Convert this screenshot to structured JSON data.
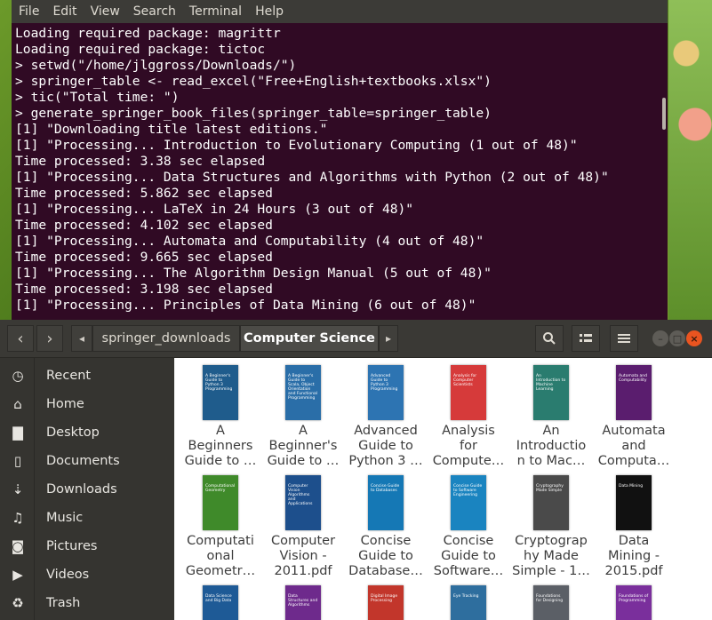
{
  "terminal": {
    "menu": [
      "File",
      "Edit",
      "View",
      "Search",
      "Terminal",
      "Help"
    ],
    "lines": [
      "Loading required package: magrittr",
      "Loading required package: tictoc",
      "> setwd(\"/home/jlggross/Downloads/\")",
      "> springer_table <- read_excel(\"Free+English+textbooks.xlsx\")",
      "> tic(\"Total time: \")",
      "> generate_springer_book_files(springer_table=springer_table)",
      "[1] \"Downloading title latest editions.\"",
      "[1] \"Processing... Introduction to Evolutionary Computing (1 out of 48)\"",
      "Time processed: 3.38 sec elapsed",
      "[1] \"Processing... Data Structures and Algorithms with Python (2 out of 48)\"",
      "Time processed: 5.862 sec elapsed",
      "[1] \"Processing... LaTeX in 24 Hours (3 out of 48)\"",
      "Time processed: 4.102 sec elapsed",
      "[1] \"Processing... Automata and Computability (4 out of 48)\"",
      "Time processed: 9.665 sec elapsed",
      "[1] \"Processing... The Algorithm Design Manual (5 out of 48)\"",
      "Time processed: 3.198 sec elapsed",
      "[1] \"Processing... Principles of Data Mining (6 out of 48)\""
    ]
  },
  "files": {
    "breadcrumb": [
      "springer_downloads",
      "Computer Science"
    ],
    "nav": {
      "back": "‹",
      "forward": "›",
      "crumb_left": "◂",
      "crumb_right": "▸"
    },
    "toolbar": {
      "search_icon": "search-icon",
      "view_icon": "list-view-icon",
      "menu_icon": "hamburger-menu-icon"
    },
    "window_controls": {
      "minimize": "–",
      "maximize": "□",
      "close": "×"
    },
    "sidebar": [
      {
        "label": "Recent",
        "icon": "clock-icon",
        "glyph": "◷"
      },
      {
        "label": "Home",
        "icon": "home-icon",
        "glyph": "⌂"
      },
      {
        "label": "Desktop",
        "icon": "folder-icon",
        "glyph": "▇"
      },
      {
        "label": "Documents",
        "icon": "document-icon",
        "glyph": "▯"
      },
      {
        "label": "Downloads",
        "icon": "download-icon",
        "glyph": "⇣"
      },
      {
        "label": "Music",
        "icon": "music-icon",
        "glyph": "♫"
      },
      {
        "label": "Pictures",
        "icon": "camera-icon",
        "glyph": "◙"
      },
      {
        "label": "Videos",
        "icon": "video-icon",
        "glyph": "▶"
      },
      {
        "label": "Trash",
        "icon": "trash-icon",
        "glyph": "♻"
      }
    ],
    "items": [
      {
        "label": "A\nBeginners\nGuide to …",
        "cover": "#1f5c8c",
        "cover_text": "A Beginner's Guide to Python 3 Programming"
      },
      {
        "label": "A\nBeginner's\nGuide to …",
        "cover": "#2a6ea8",
        "cover_text": "A Beginner's Guide to Scala, Object Orientation and Functional Programming"
      },
      {
        "label": "Advanced\nGuide to\nPython 3 …",
        "cover": "#2d74b2",
        "cover_text": "Advanced Guide to Python 3 Programming"
      },
      {
        "label": "Analysis\nfor\nCompute…",
        "cover": "#d63a3a",
        "cover_text": "Analysis for Computer Scientists"
      },
      {
        "label": "An\nIntroductio\nn to Mac…",
        "cover": "#2a7c6f",
        "cover_text": "An Introduction to Machine Learning"
      },
      {
        "label": "Automata\nand\nComputa…",
        "cover": "#5a1d6e",
        "cover_text": "Automata and Computability"
      },
      {
        "label": "Computati\nonal\nGeometr…",
        "cover": "#3f8a2a",
        "cover_text": "Computational Geometry"
      },
      {
        "label": "Computer\nVision -\n2011.pdf",
        "cover": "#1d4f8c",
        "cover_text": "Computer Vision Algorithms and Applications"
      },
      {
        "label": "Concise\nGuide to\nDatabase…",
        "cover": "#1578b5",
        "cover_text": "Concise Guide to Databases"
      },
      {
        "label": "Concise\nGuide to\nSoftware…",
        "cover": "#1a84c0",
        "cover_text": "Concise Guide to Software Engineering"
      },
      {
        "label": "Cryptograp\nhy Made\nSimple - 1…",
        "cover": "#4a4a4a",
        "cover_text": "Cryptography Made Simple"
      },
      {
        "label": "Data\nMining -\n2015.pdf",
        "cover": "#111111",
        "cover_text": "Data Mining"
      }
    ],
    "partial_row": [
      {
        "cover": "#1e5a96",
        "cover_text": "Data Science and Big Data"
      },
      {
        "cover": "#6e2a8c",
        "cover_text": "Data Structures and Algorithms"
      },
      {
        "cover": "#c2362b",
        "cover_text": "Digital Image Processing"
      },
      {
        "cover": "#2e6e9e",
        "cover_text": "Eye Tracking"
      },
      {
        "cover": "#5b5f66",
        "cover_text": "Foundations for Designing"
      },
      {
        "cover": "#7a2f9c",
        "cover_text": "Foundations of Programming"
      }
    ]
  }
}
